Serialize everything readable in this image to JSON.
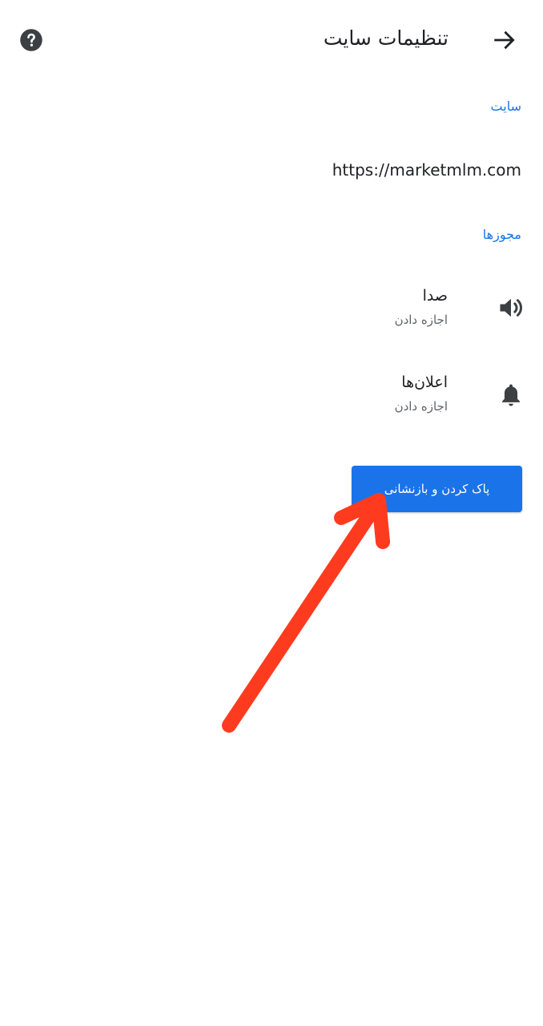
{
  "header": {
    "title": "تنظیمات سایت",
    "back_icon": "arrow-forward-icon",
    "help_icon": "help-circle-icon"
  },
  "site_section": {
    "label": "سایت",
    "url": "https://marketmlm.com"
  },
  "permissions_section": {
    "label": "مجوزها",
    "items": [
      {
        "icon": "volume-icon",
        "title": "صدا",
        "status": "اجازه دادن"
      },
      {
        "icon": "bell-icon",
        "title": "اعلان‌ها",
        "status": "اجازه دادن"
      }
    ]
  },
  "actions": {
    "reset_label": "پاک کردن و بازنشانی"
  },
  "colors": {
    "accent": "#1a73e8",
    "annotation_arrow": "#ff3b1f",
    "text_primary": "#202124",
    "text_secondary": "#5f6368"
  }
}
